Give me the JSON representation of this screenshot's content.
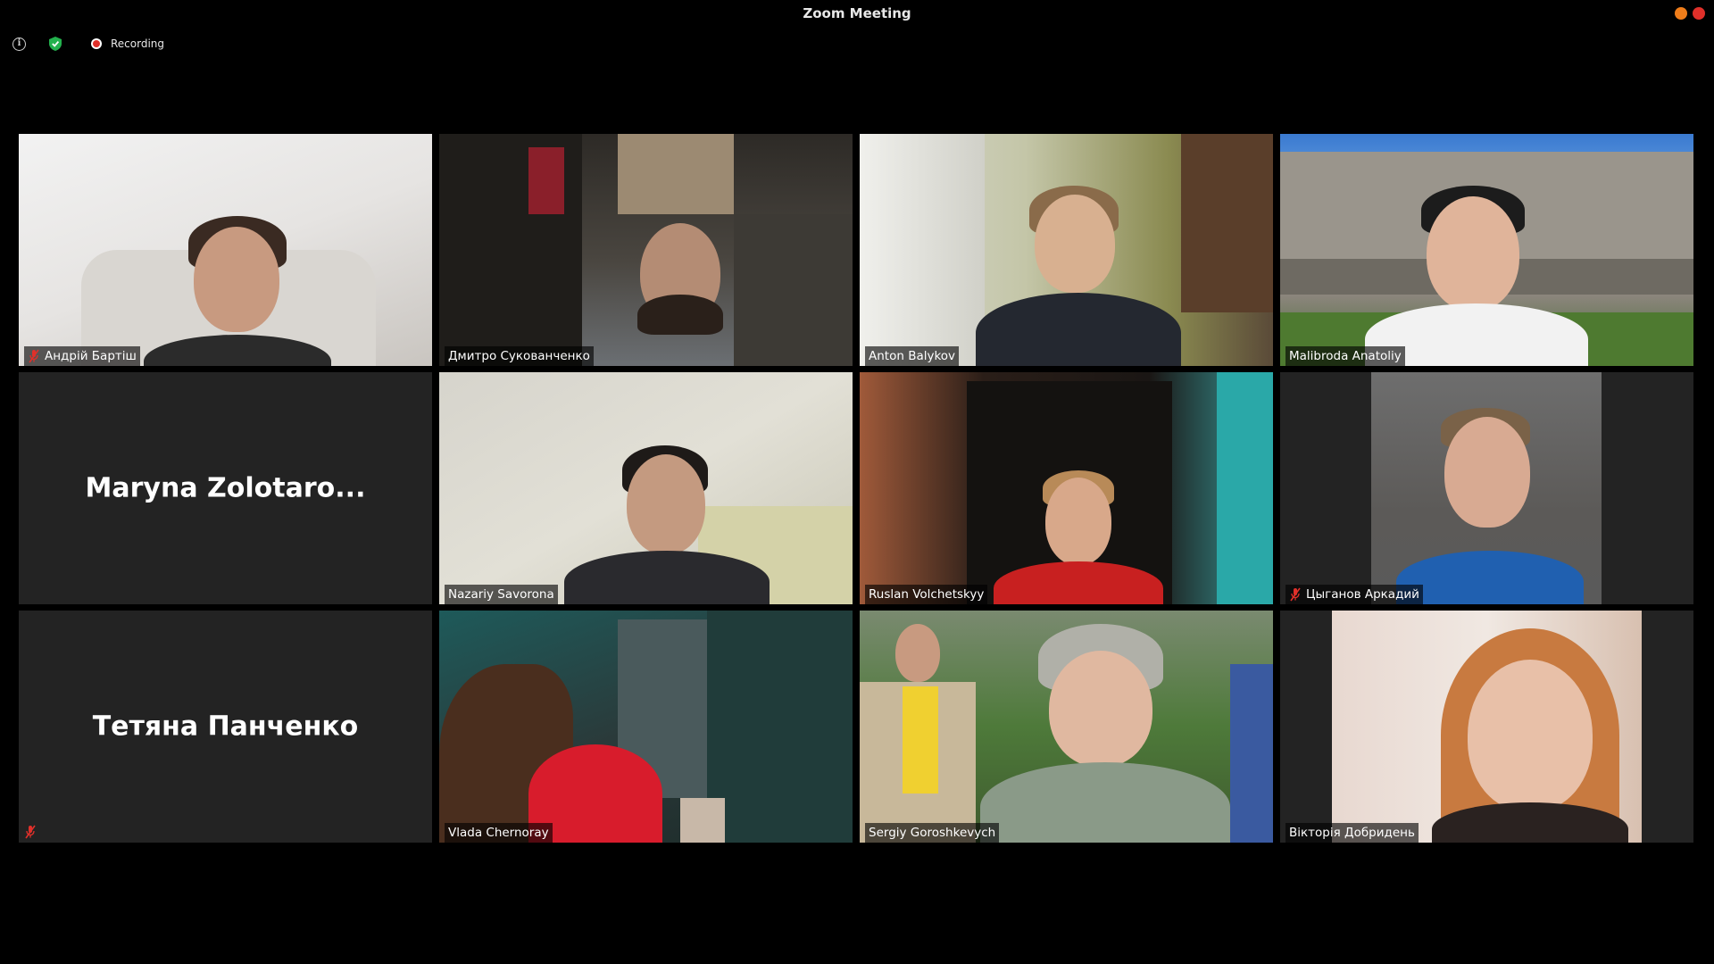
{
  "window": {
    "title": "Zoom Meeting"
  },
  "status": {
    "recording_label": "Recording",
    "icons": [
      "info-icon",
      "encryption-shield-icon",
      "recording-icon"
    ]
  },
  "colors": {
    "active_speaker_border": "#c9e66a",
    "tile_background": "#232323",
    "muted_icon": "#e0302a"
  },
  "participants": [
    {
      "name": "Андрій Бартіш",
      "muted": true,
      "video": true
    },
    {
      "name": "Дмитро Сукованченко",
      "muted": false,
      "video": true
    },
    {
      "name": "Anton Balykov",
      "muted": false,
      "video": true
    },
    {
      "name": "Malibroda Anatoliy",
      "muted": false,
      "video": true
    },
    {
      "name": "Maryna Zolotaro...",
      "muted": false,
      "video": false
    },
    {
      "name": "Nazariy Savorona",
      "muted": false,
      "video": true,
      "active_speaker": true
    },
    {
      "name": "Ruslan Volchetskyy",
      "muted": false,
      "video": true
    },
    {
      "name": "Цыганов Аркадий",
      "muted": true,
      "video": true
    },
    {
      "name": "Тетяна Панченко",
      "muted": true,
      "video": false
    },
    {
      "name": "Vlada Chernoray",
      "muted": false,
      "video": true
    },
    {
      "name": "Sergiy Goroshkevych",
      "muted": false,
      "video": true
    },
    {
      "name": "Вікторія Добридень",
      "muted": false,
      "video": true
    }
  ]
}
